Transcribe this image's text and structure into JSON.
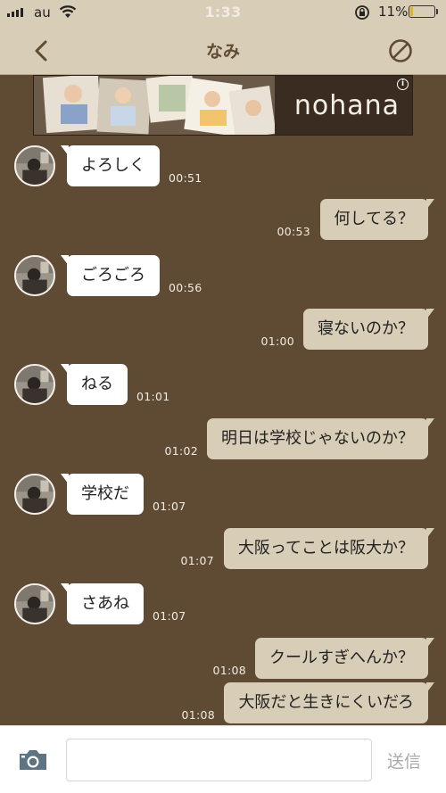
{
  "status_bar": {
    "carrier": "au",
    "time": "1:33",
    "battery": "11%",
    "battery_level": 0.11
  },
  "header": {
    "title": "なみ",
    "back_icon": "chevron-left-icon",
    "block_icon": "prohibited-icon"
  },
  "ad": {
    "brand": "nohana",
    "info_icon": "info-icon"
  },
  "messages": [
    {
      "dir": "in",
      "text": "よろしく",
      "time": "00:51"
    },
    {
      "dir": "out",
      "text": "何してる？",
      "time": "00:53"
    },
    {
      "dir": "in",
      "text": "ごろごろ",
      "time": "00:56"
    },
    {
      "dir": "out",
      "text": "寝ないのか？",
      "time": "01:00"
    },
    {
      "dir": "in",
      "text": "ねる",
      "time": "01:01"
    },
    {
      "dir": "out",
      "text": "明日は学校じゃないのか？",
      "time": "01:02"
    },
    {
      "dir": "in",
      "text": "学校だ",
      "time": "01:07"
    },
    {
      "dir": "out",
      "text": "大阪ってことは阪大か？",
      "time": "01:07"
    },
    {
      "dir": "in",
      "text": "さあね",
      "time": "01:07"
    },
    {
      "dir": "out",
      "text": "クールすぎへんか？",
      "time": "01:08"
    },
    {
      "dir": "out",
      "text": "大阪だと生きにくいだろ",
      "time": "01:08"
    }
  ],
  "input": {
    "placeholder": "",
    "value": "",
    "send_label": "送信",
    "camera_icon": "camera-icon"
  },
  "colors": {
    "background": "#5f4a34",
    "header": "#d8cdb6",
    "bubble_out": "#d8cdb6",
    "bubble_in": "#ffffff"
  }
}
